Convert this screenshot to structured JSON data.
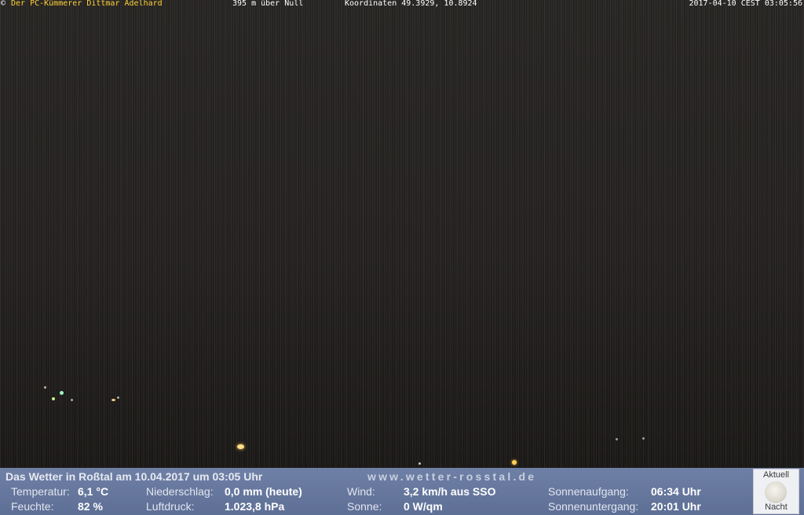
{
  "overlay": {
    "copyright_symbol": "©",
    "author": "Der PC-Kümmerer Dittmar Adelhard",
    "elevation": "395 m über Null",
    "coordinates": "Koordinaten 49.3929, 10.8924",
    "timestamp": "2017-04-10 CEST 03:05:56"
  },
  "weather": {
    "headline": "Das Wetter in Roßtal am 10.04.2017 um 03:05 Uhr",
    "website": "www.wetter-rosstal.de",
    "temperature_label": "Temperatur:",
    "temperature_value": "6,1 °C",
    "humidity_label": "Feuchte:",
    "humidity_value": "82 %",
    "precip_label": "Niederschlag:",
    "precip_value": "0,0 mm (heute)",
    "pressure_label": "Luftdruck:",
    "pressure_value": "1.023,8 hPa",
    "wind_label": "Wind:",
    "wind_value": "3,2 km/h aus SSO",
    "sun_label": "Sonne:",
    "sun_value": "0 W/qm",
    "sunrise_label": "Sonnenaufgang:",
    "sunrise_value": "06:34 Uhr",
    "sunset_label": "Sonnenuntergang:",
    "sunset_value": "20:01 Uhr"
  },
  "moon": {
    "top_label": "Aktuell",
    "bottom_label": "Nacht",
    "icon": "full-moon-icon"
  },
  "colors": {
    "author_text": "#ffd23a",
    "panel_bg": "#6a7ba2",
    "scene_bg": "#23201f"
  }
}
